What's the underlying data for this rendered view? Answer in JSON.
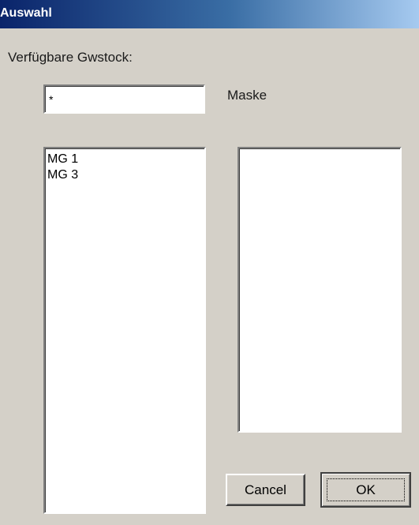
{
  "window": {
    "title": "Auswahl"
  },
  "caption": "Verfügbare Gwstock:",
  "mask": {
    "value": "*",
    "label": "Maske"
  },
  "available_list": {
    "items": [
      "MG 1",
      "MG 3"
    ]
  },
  "selected_list": {
    "items": []
  },
  "buttons": {
    "cancel_label": "Cancel",
    "ok_label": "OK"
  },
  "colors": {
    "face": "#d4d0c8",
    "titlebar_start": "#0a246a",
    "titlebar_end": "#a6caf0",
    "title_text": "#ffffff"
  }
}
